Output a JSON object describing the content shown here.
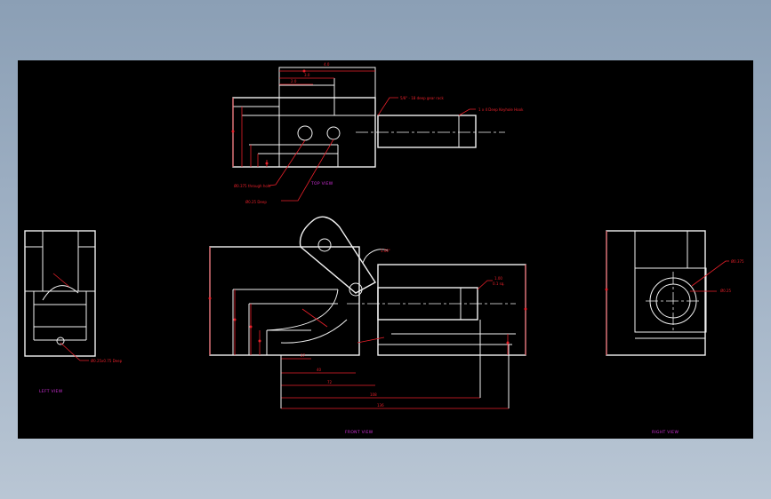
{
  "views": {
    "top": {
      "title": "TOP VIEW"
    },
    "front": {
      "title": "FRONT VIEW"
    },
    "left": {
      "title": "LEFT VIEW"
    },
    "right": {
      "title": "RIGHT VIEW"
    }
  },
  "callouts": {
    "gear_rack": "5/8\" - 18 deep gear rack",
    "keyhole": "1 x 4 Deep Keyhole Hook",
    "through_hole": "Ø0.375 through hole",
    "deep_hole": "Ø0.25 Deep",
    "left_hole": "Ø0.25x0.75 Deep",
    "chamfer": "1.00°",
    "right_od": "Ø0.375",
    "right_id": "Ø0.25"
  },
  "colors": {
    "sheet": "#000000",
    "outline": "#f2f2f2",
    "dimension": "#e8202a",
    "view_label": "#d030d8"
  }
}
